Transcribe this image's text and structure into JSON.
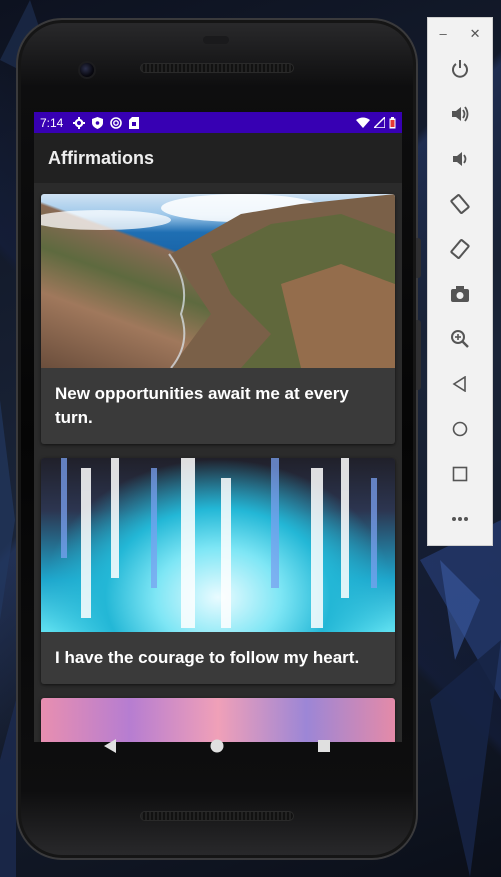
{
  "status_bar": {
    "time": "7:14",
    "left_icons": [
      "gear-icon",
      "shield-icon",
      "sync-icon",
      "sim-icon"
    ],
    "right_icons": [
      "wifi-icon",
      "signal-icon",
      "battery-icon"
    ],
    "battery_color": "#e53935"
  },
  "app_bar": {
    "title": "Affirmations"
  },
  "affirmations": [
    {
      "image": "coastline-cliffs",
      "text": "New opportunities await me at every turn."
    },
    {
      "image": "blue-crystals",
      "text": "I have the courage to follow my heart."
    },
    {
      "image": "pink-sky",
      "text": ""
    }
  ],
  "nav_bar": {
    "back_icon": "back-triangle-icon",
    "home_icon": "home-circle-icon",
    "recents_icon": "recents-square-icon"
  },
  "emulator_toolbar": {
    "window_controls": [
      "minimize-icon",
      "close-icon"
    ],
    "items": [
      "power-icon",
      "volume-up-icon",
      "volume-down-icon",
      "rotate-left-icon",
      "rotate-right-icon",
      "camera-icon",
      "zoom-icon",
      "back-icon",
      "home-icon",
      "overview-icon",
      "more-icon"
    ]
  },
  "colors": {
    "status_bar": "#3700b3",
    "app_bar": "#212121",
    "card": "#3a3a3a",
    "background": "#2b2b2b"
  }
}
